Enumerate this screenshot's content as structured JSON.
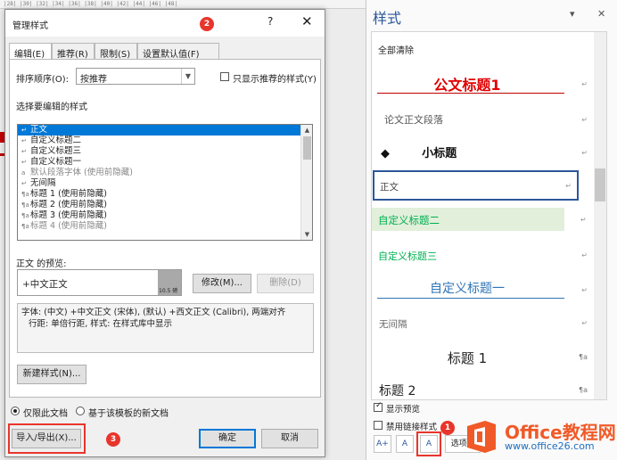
{
  "ruler_text": "|28|  |30|  |32|  |34|  |36|  |38|  |40|  |42|  |44|  |46|  |48|",
  "dialog": {
    "title": "管理样式",
    "help_icon": "?",
    "close_icon": "✕",
    "badge_title": "2",
    "tabs": [
      "编辑(E)",
      "推荐(R)",
      "限制(S)",
      "设置默认值(F)"
    ],
    "sort_label": "排序顺序(O):",
    "sort_value": "按推荐",
    "show_recommended_label": "只显示推荐的样式(Y)",
    "select_label": "选择要编辑的样式",
    "styles_list": [
      {
        "icon": "↵",
        "text": "正文",
        "selected": true,
        "gray": false
      },
      {
        "icon": "↵",
        "text": "自定义标题二",
        "selected": false,
        "gray": false
      },
      {
        "icon": "↵",
        "text": "自定义标题三",
        "selected": false,
        "gray": false
      },
      {
        "icon": "↵",
        "text": "自定义标题一",
        "selected": false,
        "gray": false
      },
      {
        "icon": "a",
        "text": "默认段落字体 (使用前隐藏)",
        "selected": false,
        "gray": true
      },
      {
        "icon": "↵",
        "text": "无间隔",
        "selected": false,
        "gray": false
      },
      {
        "icon": "¶a",
        "text": "标题 1 (使用前隐藏)",
        "selected": false,
        "gray": false
      },
      {
        "icon": "¶a",
        "text": "标题 2 (使用前隐藏)",
        "selected": false,
        "gray": false
      },
      {
        "icon": "¶a",
        "text": "标题 3 (使用前隐藏)",
        "selected": false,
        "gray": false
      },
      {
        "icon": "¶a",
        "text": "标题 4 (使用前隐藏)",
        "selected": false,
        "gray": true
      }
    ],
    "preview_label": "正文 的预览:",
    "preview_text": "+中文正文",
    "preview_size": "10.5 磅",
    "modify_button": "修改(M)...",
    "delete_button": "删除(D)",
    "description_line1": "字体: (中文) +中文正文 (宋体), (默认) +西文正文 (Calibri), 两端对齐",
    "description_line2": "行距: 单倍行距, 样式: 在样式库中显示",
    "new_style_button": "新建样式(N)...",
    "radio_this_doc": "仅限此文档",
    "radio_template": "基于该模板的新文档",
    "import_export_button": "导入/导出(X)...",
    "badge_import": "3",
    "ok_button": "确定",
    "cancel_button": "取消"
  },
  "pane": {
    "title": "样式",
    "dropdown_icon": "▾",
    "close_icon": "✕",
    "clear_all": "全部清除",
    "styles": [
      {
        "text": "公文标题1",
        "mark": "↵"
      },
      {
        "text": "论文正文段落",
        "mark": "↵"
      },
      {
        "text": "◆        小标题",
        "mark": "↵"
      },
      {
        "text": "正文",
        "mark": "↵"
      },
      {
        "text": "自定义标题二",
        "mark": "↵"
      },
      {
        "text": "自定义标题三",
        "mark": "↵"
      },
      {
        "text": "自定义标题一",
        "mark": "↵"
      },
      {
        "text": "无间隔",
        "mark": "↵"
      },
      {
        "text": "标题 1",
        "mark": "¶a"
      },
      {
        "text": "标题 2",
        "mark": "¶a"
      }
    ],
    "show_preview_label": "显示预览",
    "disable_linked_label": "禁用链接样式",
    "badge_manage": "1",
    "new_style_icon": "A+",
    "inspector_icon": "A",
    "manage_styles_icon": "A",
    "options_button": "选项..."
  },
  "watermark": {
    "title": "Office教程网",
    "url": "www.office26.com"
  },
  "colors": {
    "accent_red": "#e8352c",
    "accent_blue": "#0078d7",
    "heading_red": "#c00000",
    "heading_blue": "#2e75b6",
    "green": "#00b050",
    "brand_orange": "#f05a28"
  }
}
